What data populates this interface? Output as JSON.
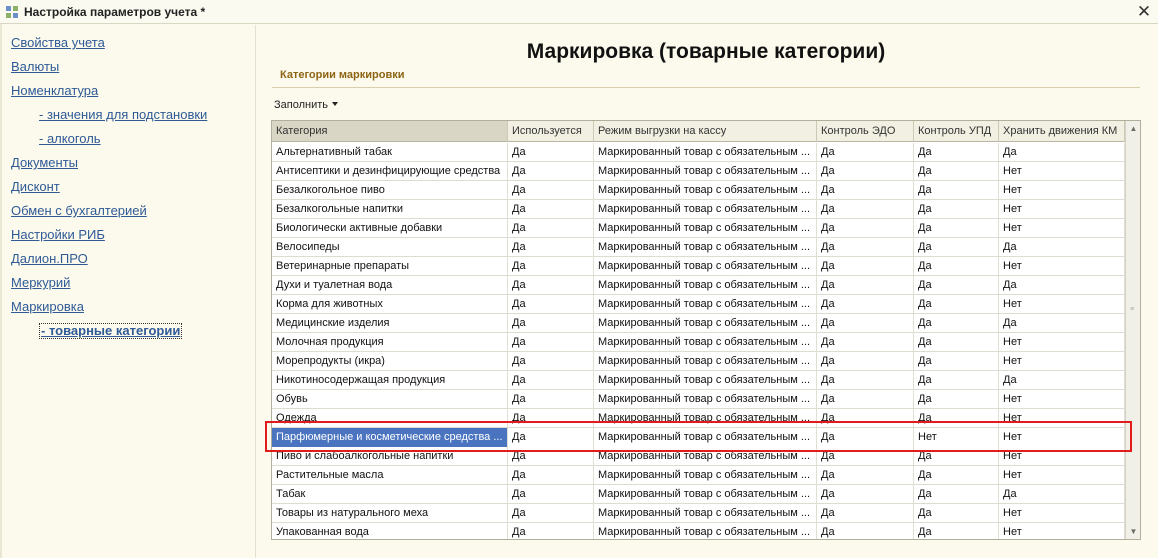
{
  "window": {
    "title": "Настройка параметров учета *",
    "close_label": "✕"
  },
  "sidebar": {
    "items": [
      {
        "label": "Свойства учета"
      },
      {
        "label": "Валюты"
      },
      {
        "label": "Номенклатура"
      },
      {
        "label": "- значения для подстановки"
      },
      {
        "label": "- алкоголь"
      },
      {
        "label": "Документы"
      },
      {
        "label": "Дисконт"
      },
      {
        "label": "Обмен с бухгалтерией"
      },
      {
        "label": "Настройки РИБ"
      },
      {
        "label": "Далион.ПРО"
      },
      {
        "label": "Меркурий"
      },
      {
        "label": "Маркировка"
      },
      {
        "label": "- товарные категории"
      }
    ]
  },
  "main": {
    "title": "Маркировка (товарные категории)",
    "section_title": "Категории маркировки",
    "fill_label": "Заполнить",
    "table": {
      "columns": [
        "Категория",
        "Используется",
        "Режим выгрузки на кассу",
        "Контроль ЭДО",
        "Контроль УПД",
        "Хранить движения КМ"
      ],
      "rows": [
        [
          "Альтернативный табак",
          "Да",
          "Маркированный товар с обязательным ...",
          "Да",
          "Да",
          "Да"
        ],
        [
          "Антисептики и дезинфицирующие средства",
          "Да",
          "Маркированный товар с обязательным ...",
          "Да",
          "Да",
          "Нет"
        ],
        [
          "Безалкогольное пиво",
          "Да",
          "Маркированный товар с обязательным ...",
          "Да",
          "Да",
          "Нет"
        ],
        [
          "Безалкогольные напитки",
          "Да",
          "Маркированный товар с обязательным ...",
          "Да",
          "Да",
          "Нет"
        ],
        [
          "Биологически активные добавки",
          "Да",
          "Маркированный товар с обязательным ...",
          "Да",
          "Да",
          "Нет"
        ],
        [
          "Велосипеды",
          "Да",
          "Маркированный товар с обязательным ...",
          "Да",
          "Да",
          "Да"
        ],
        [
          "Ветеринарные препараты",
          "Да",
          "Маркированный товар с обязательным ...",
          "Да",
          "Да",
          "Нет"
        ],
        [
          "Духи и туалетная вода",
          "Да",
          "Маркированный товар с обязательным ...",
          "Да",
          "Да",
          "Да"
        ],
        [
          "Корма для животных",
          "Да",
          "Маркированный товар с обязательным ...",
          "Да",
          "Да",
          "Нет"
        ],
        [
          "Медицинские изделия",
          "Да",
          "Маркированный товар с обязательным ...",
          "Да",
          "Да",
          "Да"
        ],
        [
          "Молочная продукция",
          "Да",
          "Маркированный товар с обязательным ...",
          "Да",
          "Да",
          "Нет"
        ],
        [
          "Морепродукты (икра)",
          "Да",
          "Маркированный товар с обязательным ...",
          "Да",
          "Да",
          "Нет"
        ],
        [
          "Никотиносодержащая продукция",
          "Да",
          "Маркированный товар с обязательным ...",
          "Да",
          "Да",
          "Да"
        ],
        [
          "Обувь",
          "Да",
          "Маркированный товар с обязательным ...",
          "Да",
          "Да",
          "Нет"
        ],
        [
          "Одежда",
          "Да",
          "Маркированный товар с обязательным ...",
          "Да",
          "Да",
          "Нет"
        ],
        [
          "Парфюмерные и косметические средства ...",
          "Да",
          "Маркированный товар с обязательным ...",
          "Да",
          "Нет",
          "Нет"
        ],
        [
          "Пиво и слабоалкогольные напитки",
          "Да",
          "Маркированный товар с обязательным ...",
          "Да",
          "Да",
          "Нет"
        ],
        [
          "Растительные масла",
          "Да",
          "Маркированный товар с обязательным ...",
          "Да",
          "Да",
          "Нет"
        ],
        [
          "Табак",
          "Да",
          "Маркированный товар с обязательным ...",
          "Да",
          "Да",
          "Да"
        ],
        [
          "Товары из натурального меха",
          "Да",
          "Маркированный товар с обязательным ...",
          "Да",
          "Да",
          "Нет"
        ],
        [
          "Упакованная вода",
          "Да",
          "Маркированный товар с обязательным ...",
          "Да",
          "Да",
          "Нет"
        ]
      ],
      "selected_row": 15
    }
  },
  "colors": {
    "link": "#2f5a96",
    "section": "#8d6413",
    "selection": "#4b74c0",
    "highlight": "#e21b1b"
  }
}
